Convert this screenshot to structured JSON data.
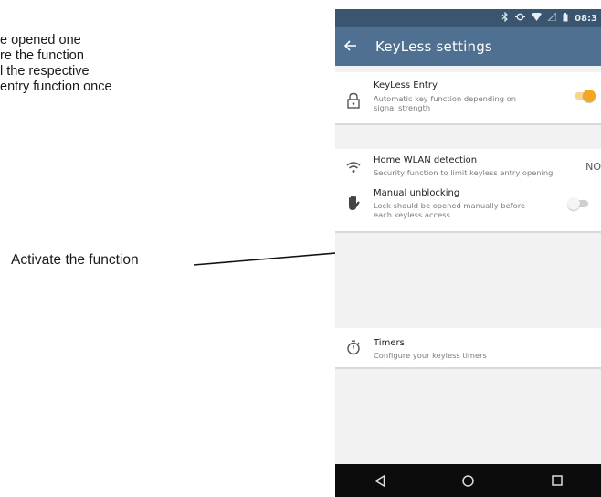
{
  "manual": {
    "lines": [
      "e opened one",
      "re the function",
      "l the respective",
      "entry function once"
    ],
    "callout": "Activate the function"
  },
  "status_bar": {
    "time": "08:3",
    "icons": [
      "bluetooth-icon",
      "sync-icon",
      "wifi-icon",
      "signal-icon",
      "battery-icon"
    ]
  },
  "app_bar": {
    "title": "KeyLess settings",
    "back_icon": "back-arrow-icon",
    "color": "#4f7090"
  },
  "settings": {
    "keyless_entry": {
      "title": "KeyLess Entry",
      "subtitle_line1": "Automatic key function depending on",
      "subtitle_line2": "signal strength",
      "enabled": true,
      "icon": "lock-icon"
    },
    "home_wlan": {
      "title": "Home WLAN detection",
      "subtitle": "Security function to limit keyless entry opening",
      "value": "NO",
      "icon": "wifi-icon"
    },
    "manual_unblocking": {
      "title": "Manual unblocking",
      "subtitle_line1": "Lock should be opened manually before",
      "subtitle_line2": "each keyless access",
      "enabled": false,
      "icon": "hand-icon"
    },
    "timers": {
      "title": "Timers",
      "subtitle": "Configure your keyless timers",
      "icon": "timer-icon"
    }
  },
  "nav_bar": {
    "buttons": [
      "back-triangle-icon",
      "home-circle-icon",
      "recents-square-icon"
    ]
  },
  "colors": {
    "accent_toggle": "#f5a623",
    "status_bar": "#3a5570"
  }
}
